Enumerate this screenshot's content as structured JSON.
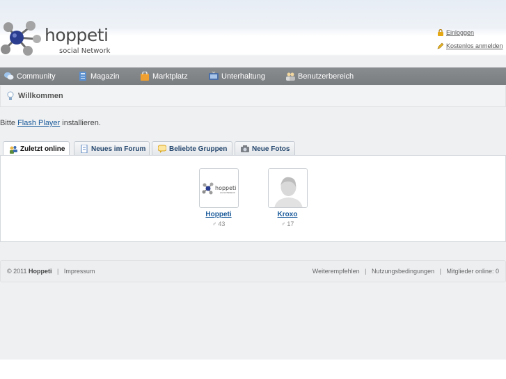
{
  "header": {
    "logo_name": "hoppeti",
    "logo_tagline": "social Network",
    "login_label": "Einloggen",
    "register_label": "Kostenlos anmelden"
  },
  "nav": {
    "items": [
      {
        "label": "Community",
        "icon": "chat-bubbles-icon"
      },
      {
        "label": "Magazin",
        "icon": "magazine-icon"
      },
      {
        "label": "Marktplatz",
        "icon": "shopping-bag-icon"
      },
      {
        "label": "Unterhaltung",
        "icon": "tv-icon"
      },
      {
        "label": "Benutzerbereich",
        "icon": "users-icon"
      }
    ]
  },
  "welcome": {
    "title": "Willkommen"
  },
  "flash": {
    "before": "Bitte ",
    "link": "Flash Player",
    "after": " installieren."
  },
  "tabs": [
    {
      "label": "Zuletzt online",
      "active": true
    },
    {
      "label": "Neues im Forum",
      "active": false
    },
    {
      "label": "Beliebte Gruppen",
      "active": false
    },
    {
      "label": "Neue Fotos",
      "active": false
    }
  ],
  "members": [
    {
      "name": "Hoppeti",
      "count": "43",
      "gender_icon": "male-symbol-icon"
    },
    {
      "name": "Kroxo",
      "count": "17",
      "gender_icon": "male-symbol-icon"
    }
  ],
  "footer": {
    "copyright": "© 2011",
    "brand": "Hoppeti",
    "impressum": "Impressum",
    "recommend": "Weiterempfehlen",
    "terms": "Nutzungsbedingungen",
    "online": "Mitglieder online: 0"
  },
  "colors": {
    "navbar": "#7f8285",
    "link": "#1a5a9a",
    "tab_text": "#24476e"
  }
}
